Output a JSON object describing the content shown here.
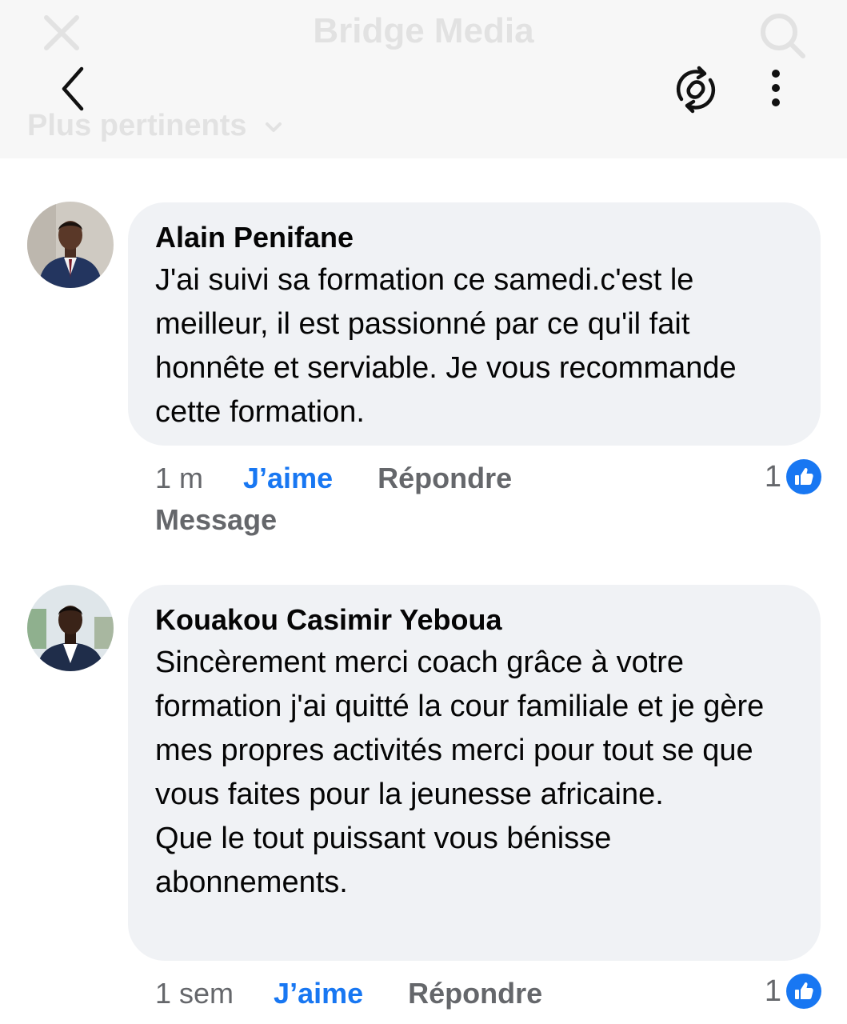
{
  "header": {
    "title": "Bridge Media",
    "sort_label": "Plus pertinents",
    "icons": [
      "close-icon",
      "search-icon",
      "back-arrow-icon",
      "sync-icon",
      "more-vertical-icon",
      "chevron-down-icon"
    ]
  },
  "comments": [
    {
      "author": "Alain Penifane",
      "text": "J'ai suivi sa formation ce samedi.c'est le meilleur, il est passionné par ce qu'il fait honnête et serviable. Je vous recommande cette formation.",
      "time": "1 m",
      "like_label": "J’aime",
      "reply_label": "Répondre",
      "message_label": "Message",
      "reaction_count": "1"
    },
    {
      "author": "Kouakou Casimir Yeboua",
      "text": "Sincèrement merci coach grâce à votre formation j'ai quitté la cour familiale et je gère mes propres activités merci pour tout se que vous faites pour la jeunesse africaine.\nQue le tout puissant vous bénisse abonnements.",
      "time": "1 sem",
      "like_label": "J’aime",
      "reply_label": "Répondre",
      "reaction_count": "1"
    }
  ],
  "colors": {
    "accent": "#1877f2",
    "bubble": "#f0f2f5",
    "meta_text": "#65676b",
    "header_bg": "#f7f7f7"
  }
}
